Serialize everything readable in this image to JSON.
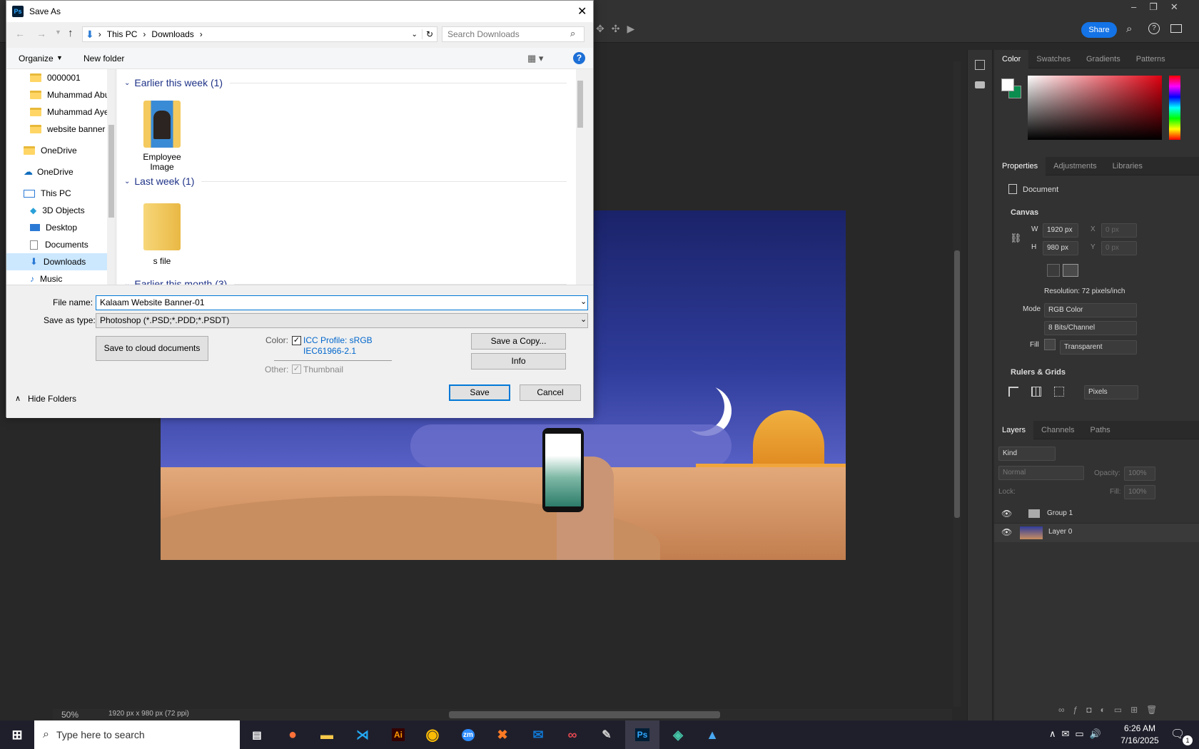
{
  "photoshop": {
    "share_label": "Share",
    "zoom": "50%",
    "doc_info": "1920 px x 980 px (72 ppi)",
    "color_tabs": [
      "Color",
      "Swatches",
      "Gradients",
      "Patterns"
    ],
    "props_tabs": [
      "Properties",
      "Adjustments",
      "Libraries"
    ],
    "props": {
      "doc_label": "Document",
      "canvas_label": "Canvas",
      "w_label": "W",
      "w_value": "1920 px",
      "h_label": "H",
      "h_value": "980 px",
      "x_label": "X",
      "x_value": "0 px",
      "y_label": "Y",
      "y_value": "0 px",
      "resolution": "Resolution: 72 pixels/inch",
      "mode_label": "Mode",
      "mode_value": "RGB Color",
      "bits_value": "8 Bits/Channel",
      "fill_label": "Fill",
      "fill_value": "Transparent",
      "rulers_label": "Rulers & Grids",
      "units_value": "Pixels"
    },
    "layers_tabs": [
      "Layers",
      "Channels",
      "Paths"
    ],
    "layers": {
      "kind_label": "Kind",
      "blend": "Normal",
      "opacity_label": "Opacity:",
      "opacity": "100%",
      "lock_label": "Lock:",
      "fill_label": "Fill:",
      "fill": "100%",
      "items": [
        {
          "name": "Group 1"
        },
        {
          "name": "Layer 0"
        }
      ]
    }
  },
  "dialog": {
    "title": "Save As",
    "breadcrumb": [
      "This PC",
      "Downloads"
    ],
    "search_placeholder": "Search Downloads",
    "organize": "Organize",
    "new_folder": "New folder",
    "nav_items": [
      {
        "label": "0000001",
        "indent": 2
      },
      {
        "label": "Muhammad Abu",
        "indent": 2
      },
      {
        "label": "Muhammad Ayes",
        "indent": 2
      },
      {
        "label": "website banner",
        "indent": 2
      },
      {
        "label": "OneDrive",
        "indent": 1
      },
      {
        "label": "OneDrive",
        "indent": 1
      },
      {
        "label": "This PC",
        "indent": 1
      },
      {
        "label": "3D Objects",
        "indent": 2
      },
      {
        "label": "Desktop",
        "indent": 2
      },
      {
        "label": "Documents",
        "indent": 2
      },
      {
        "label": "Downloads",
        "indent": 2
      },
      {
        "label": "Music",
        "indent": 2
      }
    ],
    "groups": [
      {
        "label": "Earlier this week (1)",
        "file": "Employee Image"
      },
      {
        "label": "Last week (1)",
        "file": "s file"
      },
      {
        "label": "Earlier this month (3)",
        "file": ""
      }
    ],
    "file_name_label": "File name:",
    "file_name": "Kalaam Website Banner-01",
    "save_type_label": "Save as type:",
    "save_type": "Photoshop (*.PSD;*.PDD;*.PSDT)",
    "cloud_btn": "Save to cloud documents",
    "color_label": "Color:",
    "icc_line1": "ICC Profile:  sRGB",
    "icc_line2": "IEC61966-2.1",
    "other_label": "Other:",
    "thumbnail": "Thumbnail",
    "save_copy": "Save a Copy...",
    "info": "Info",
    "save": "Save",
    "cancel": "Cancel",
    "hide_folders": "Hide Folders"
  },
  "taskbar": {
    "search_placeholder": "Type here to search",
    "time": "6:26 AM",
    "date": "7/16/2025",
    "notif_count": "1"
  }
}
